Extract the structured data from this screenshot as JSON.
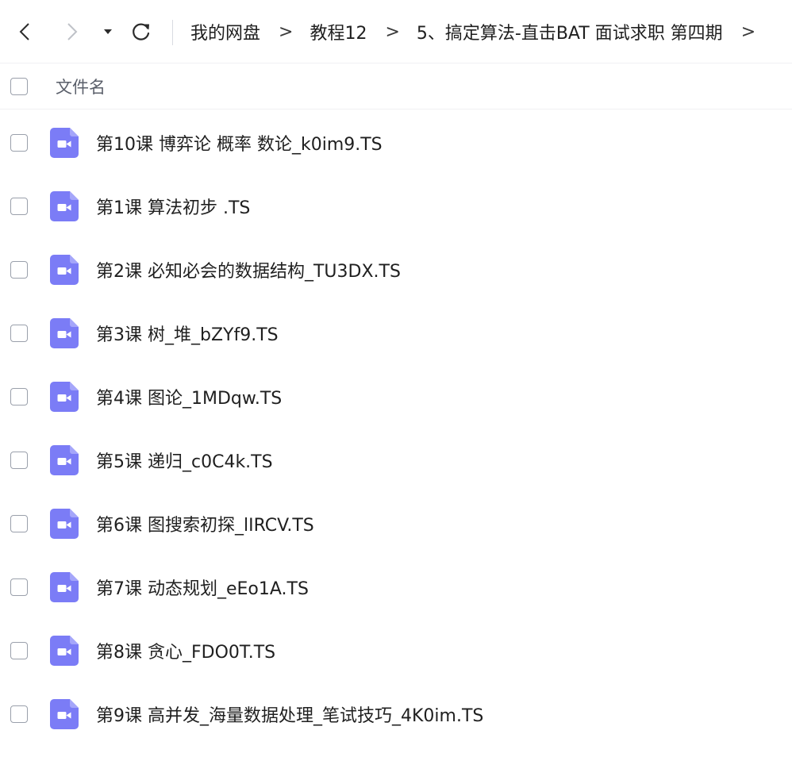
{
  "navbar": {
    "back_icon": "chevron-left-icon",
    "forward_icon": "chevron-right-icon",
    "menu_icon": "caret-down-icon",
    "refresh_icon": "refresh-icon",
    "breadcrumb": {
      "items": [
        "我的网盘",
        "教程12",
        "5、搞定算法-直击BAT 面试求职 第四期"
      ],
      "separator": ">"
    }
  },
  "list_header": {
    "column_name": "文件名"
  },
  "colors": {
    "video_icon": "#7b7cf6",
    "checkbox_border": "#9aa0ab",
    "divider": "#f0f0f3"
  },
  "files": [
    {
      "name": "第10课 博弈论 概率 数论_k0im9.TS",
      "icon": "video-file-icon"
    },
    {
      "name": "第1课 算法初步 .TS",
      "icon": "video-file-icon"
    },
    {
      "name": "第2课 必知必会的数据结构_TU3DX.TS",
      "icon": "video-file-icon"
    },
    {
      "name": "第3课 树_堆_bZYf9.TS",
      "icon": "video-file-icon"
    },
    {
      "name": "第4课 图论_1MDqw.TS",
      "icon": "video-file-icon"
    },
    {
      "name": "第5课 递归_c0C4k.TS",
      "icon": "video-file-icon"
    },
    {
      "name": "第6课 图搜索初探_lIRCV.TS",
      "icon": "video-file-icon"
    },
    {
      "name": "第7课 动态规划_eEo1A.TS",
      "icon": "video-file-icon"
    },
    {
      "name": "第8课 贪心_FDO0T.TS",
      "icon": "video-file-icon"
    },
    {
      "name": "第9课 高并发_海量数据处理_笔试技巧_4K0im.TS",
      "icon": "video-file-icon"
    }
  ]
}
